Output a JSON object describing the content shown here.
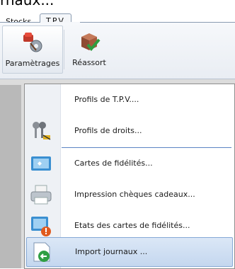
{
  "top_partial_text": "rnaux...",
  "tabs": [
    {
      "label": "Stocks"
    },
    {
      "label": "T.P.V."
    }
  ],
  "ribbon": {
    "buttons": [
      {
        "label": "Paramètrages",
        "icon": "settings-icon"
      },
      {
        "label": "Réassort",
        "icon": "restock-icon"
      }
    ]
  },
  "menu": {
    "items": [
      {
        "label": "Profils de T.P.V....",
        "icon": "none"
      },
      {
        "label": "Profils de droits...",
        "icon": "keys-icon"
      },
      {
        "label": "Cartes de fidélités...",
        "icon": "card-icon"
      },
      {
        "label": "Impression chèques cadeaux...",
        "icon": "printer-icon"
      },
      {
        "label": "Etats des cartes de fidélités...",
        "icon": "card-report-icon"
      },
      {
        "label": "Import journaux ...",
        "icon": "import-icon",
        "selected": true
      }
    ]
  },
  "colors": {
    "accent": "#5c84c4",
    "selected_bg": "#c4d7ef",
    "workspace": "#dcdcdc"
  }
}
